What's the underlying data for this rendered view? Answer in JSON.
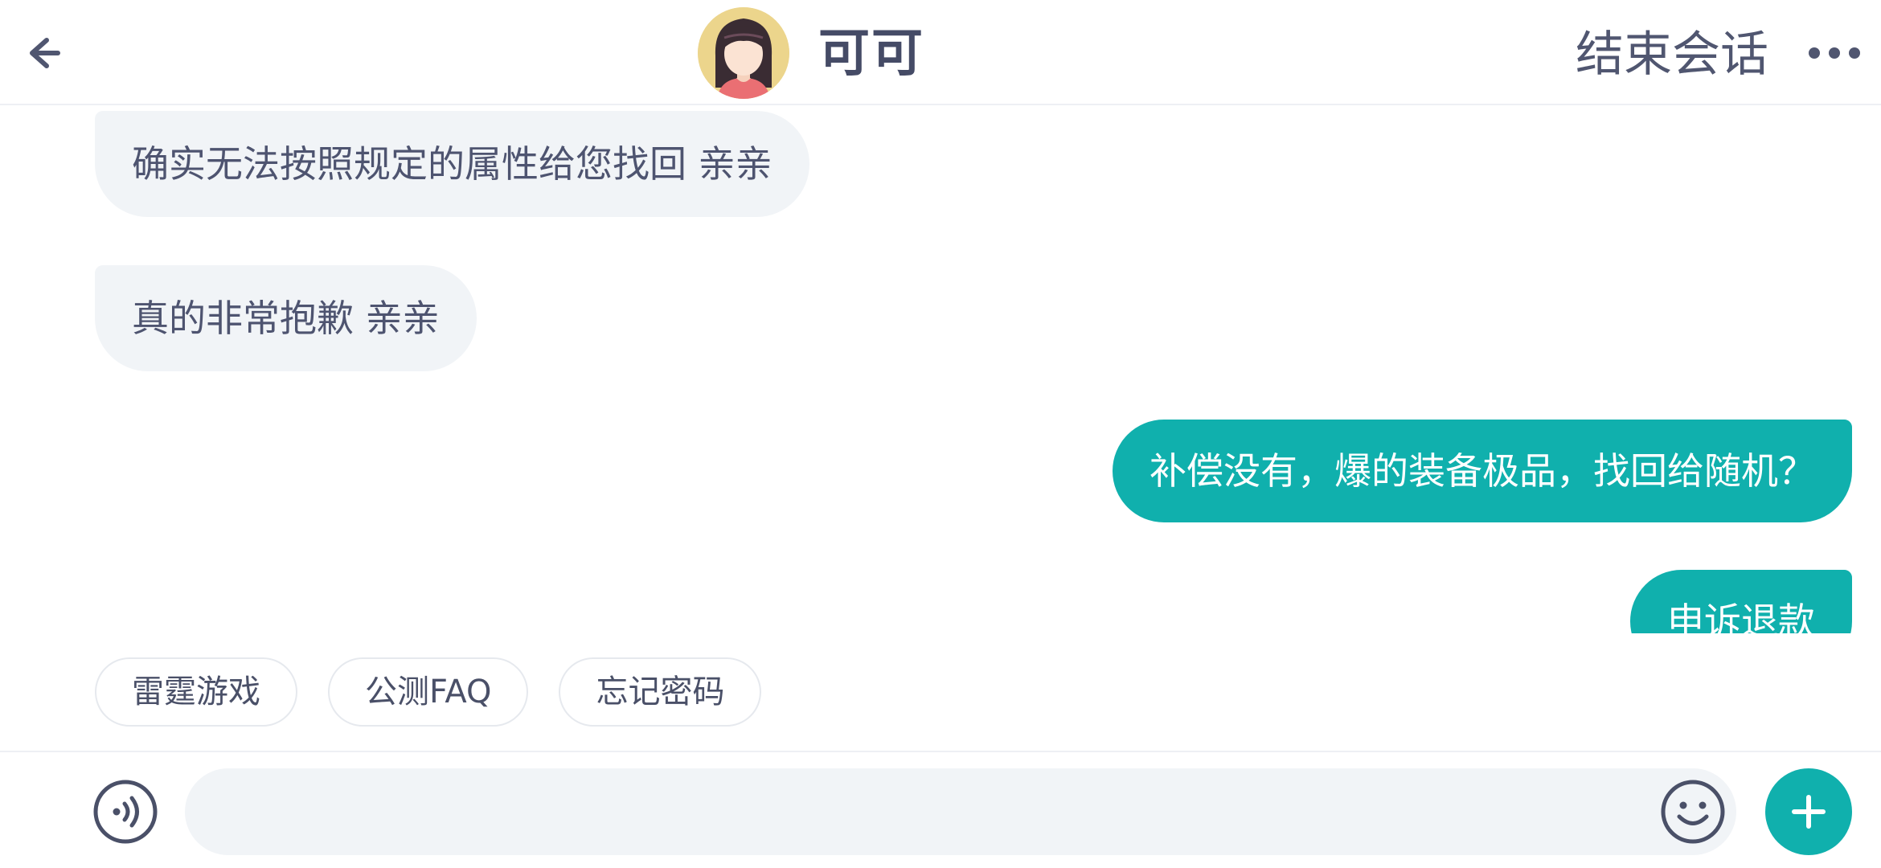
{
  "header": {
    "contact_name": "可可",
    "end_session_label": "结束会话",
    "back_icon": "arrow-left-icon",
    "more_icon": "ellipsis-horizontal-icon"
  },
  "messages": [
    {
      "direction": "incoming",
      "text": "确实无法按照规定的属性给您找回 亲亲"
    },
    {
      "direction": "incoming",
      "text": "真的非常抱歉 亲亲"
    },
    {
      "direction": "outgoing",
      "text": "补偿没有，爆的装备极品，找回给随机？"
    },
    {
      "direction": "outgoing",
      "text": "申诉退款"
    }
  ],
  "quick_replies": [
    {
      "label": "雷霆游戏"
    },
    {
      "label": "公测FAQ"
    },
    {
      "label": "忘记密码"
    }
  ],
  "composer": {
    "placeholder": "",
    "value": "",
    "voice_icon": "voice-input-icon",
    "emoji_icon": "emoji-smile-icon",
    "plus_icon": "plus-icon"
  },
  "colors": {
    "accent": "#10b0ad",
    "incoming_bubble": "#f1f4f7",
    "text_primary": "#4a5068"
  }
}
